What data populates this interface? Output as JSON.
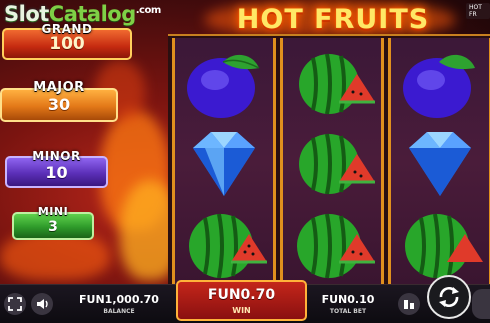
{
  "brand": {
    "part_a": "Slot",
    "part_b": "Catalog",
    "part_c": ".com"
  },
  "game_title": "HOT FRUITS",
  "corner_tag": "HOT FR",
  "jackpots": [
    {
      "name": "GRAND",
      "value": "100"
    },
    {
      "name": "MAJOR",
      "value": "30"
    },
    {
      "name": "MINOR",
      "value": "10"
    },
    {
      "name": "MINI",
      "value": "3"
    }
  ],
  "reels": [
    [
      "plum",
      "diamond",
      "watermelon"
    ],
    [
      "watermelon",
      "watermelon",
      "watermelon"
    ],
    [
      "plum",
      "diamond",
      "watermelon"
    ]
  ],
  "footer": {
    "balance_value": "FUN1,000.70",
    "balance_label": "BALANCE",
    "win_value": "FUN0.70",
    "win_label": "WIN",
    "total_bet_value": "FUN0.10",
    "total_bet_label": "TOTAL BET"
  },
  "icons": {
    "fullscreen": "fullscreen-icon",
    "sound": "speaker-icon",
    "stack": "coin-stack-icon",
    "spin": "spin-arrows-icon"
  },
  "colors": {
    "grand": "#d7401c",
    "major": "#e07a18",
    "minor": "#5b2fb8",
    "mini": "#2e9a2a",
    "reel_frame": "#e0901e"
  }
}
